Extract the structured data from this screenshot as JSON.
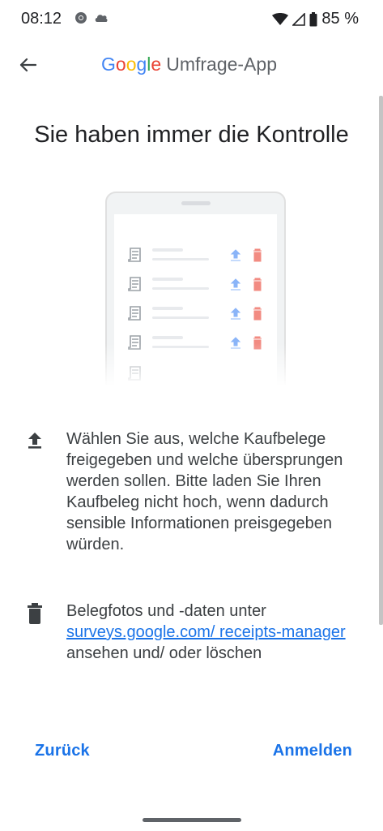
{
  "status_bar": {
    "time": "08:12",
    "battery_percent": "85 %",
    "left_icons": [
      "chrome-icon",
      "cloud-icon"
    ],
    "right_icons": [
      "wifi-icon",
      "cell-signal-icon",
      "battery-icon"
    ]
  },
  "app_bar": {
    "logo_letters": [
      {
        "char": "G",
        "color": "#4285F4"
      },
      {
        "char": "o",
        "color": "#EA4335"
      },
      {
        "char": "o",
        "color": "#FBBC05"
      },
      {
        "char": "g",
        "color": "#4285F4"
      },
      {
        "char": "l",
        "color": "#34A853"
      },
      {
        "char": "e",
        "color": "#EA4335"
      }
    ],
    "title": "Umfrage-App",
    "back_icon": "arrow-left-icon"
  },
  "headline": "Sie haben immer die Kontrolle",
  "info": {
    "item1": {
      "icon": "upload-icon",
      "text": "Wählen Sie aus, welche Kaufbelege freigegeben und welche übersprungen werden sollen. Bitte laden Sie Ihren Kaufbeleg nicht hoch, wenn dadurch sensible Informationen preisgegeben würden."
    },
    "item2": {
      "icon": "trash-icon",
      "text_before": "Belegfotos und -daten unter ",
      "link": "surveys.google.com/ receipts-manager",
      "text_after": " ansehen und/ oder löschen"
    }
  },
  "buttons": {
    "back": "Zurück",
    "login": "Anmelden"
  },
  "colors": {
    "accent": "#1a73e8",
    "upload_icon_light": "#8ab4f8",
    "trash_icon_light": "#f28b82"
  }
}
